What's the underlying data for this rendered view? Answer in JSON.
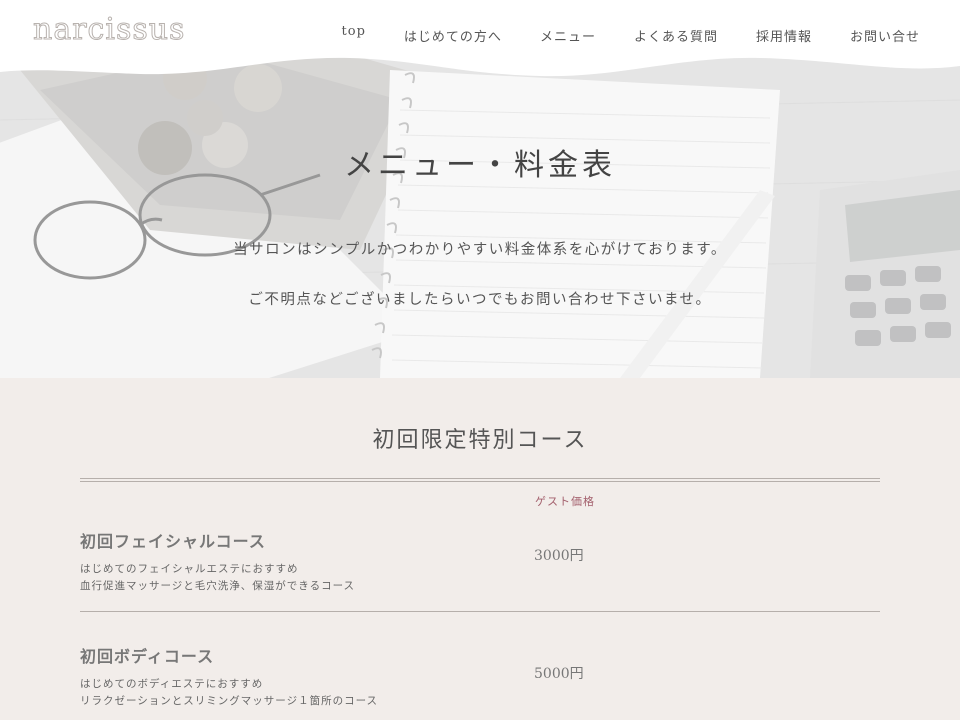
{
  "header": {
    "logo": "narcissus",
    "nav": [
      "top",
      "はじめての方へ",
      "メニュー",
      "よくある質問",
      "採用情報",
      "お問い合せ"
    ]
  },
  "hero": {
    "title": "メニュー・料金表",
    "lines": [
      "当サロンはシンプルかつわかりやすい料金体系を心がけております。",
      "ご不明点などございましたらいつでもお問い合わせ下さいませ。"
    ]
  },
  "section": {
    "title": "初回限定特別コース",
    "column_header": "ゲスト価格",
    "courses": [
      {
        "name": "初回フェイシャルコース",
        "desc1": "はじめてのフェイシャルエステにおすすめ",
        "desc2": "血行促進マッサージと毛穴洗浄、保湿ができるコース",
        "price": "3000円"
      },
      {
        "name": "初回ボディコース",
        "desc1": "はじめてのボディエステにおすすめ",
        "desc2": "リラクゼーションとスリミングマッサージ１箇所のコース",
        "price": "5000円"
      }
    ]
  },
  "colors": {
    "background": "#f2edea",
    "accent": "#a35f6c",
    "rule": "#b6afab"
  }
}
